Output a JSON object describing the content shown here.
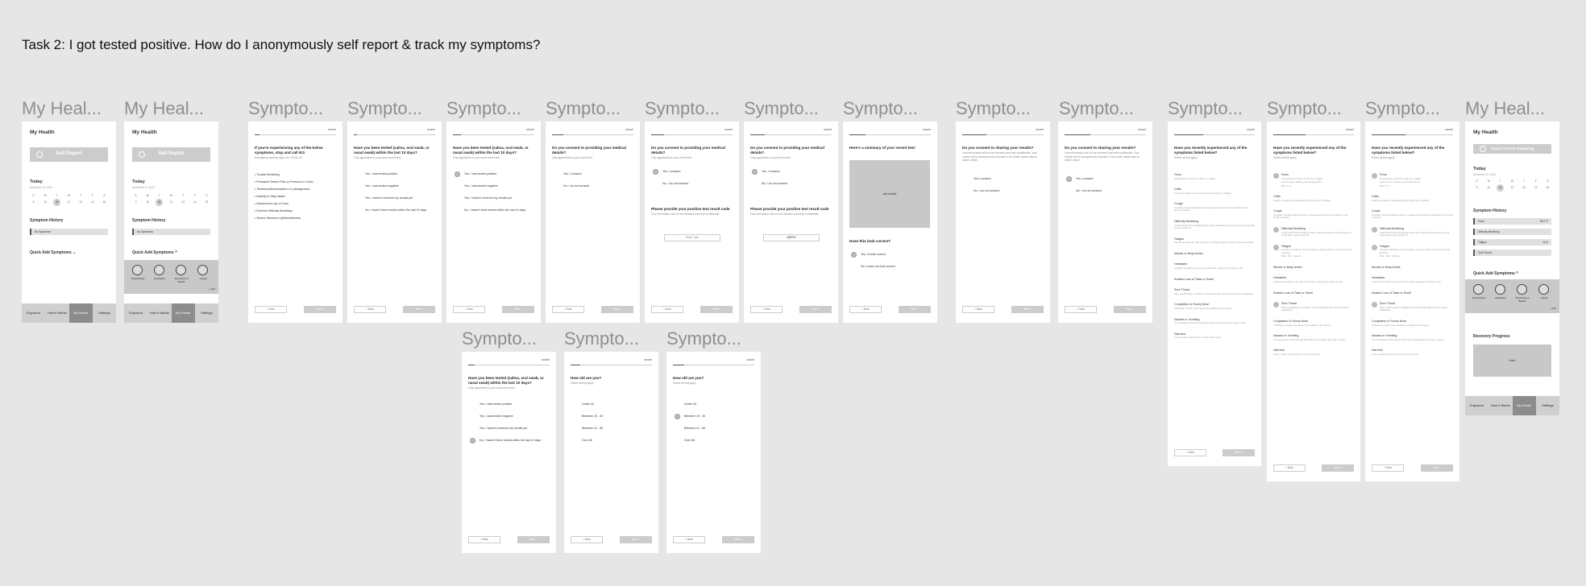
{
  "task": "Task 2: I got tested positive. How do I anonymously self report & track my symptoms?",
  "labels": {
    "my_health": "My Heal...",
    "symptoms": "Sympto..."
  },
  "nav": {
    "cancel": "cancel",
    "back": "< Back",
    "next": "Next >"
  },
  "my_health": {
    "title": "My Health",
    "self_report": "Self Report",
    "thank_you": "Thank You For Reporting",
    "today": "Today",
    "date": "November 11, 2020",
    "week_days": [
      "S",
      "M",
      "T",
      "W",
      "T",
      "F",
      "S"
    ],
    "week_nums": [
      "9",
      "10",
      "11",
      "12",
      "13",
      "14",
      "15"
    ],
    "history_title": "Symptom History",
    "no_symptoms": "No Symptoms",
    "quick_add": "Quick Add Symptoms",
    "chev_down": "⌄",
    "chev_up": "^",
    "quick_items": [
      "Temperature",
      "Headache",
      "Shortness of Breath",
      "Cough"
    ],
    "add_link": "+ Add",
    "history_items": [
      {
        "name": "Fever",
        "val": "99.5 °F"
      },
      {
        "name": "Difficulty Breathing",
        "val": ""
      },
      {
        "name": "Fatigue",
        "val": "4/10"
      },
      {
        "name": "Sore Throat",
        "val": ""
      }
    ],
    "recovery_title": "Recovery Progress",
    "chart": "chart",
    "tabs": [
      "Exposure",
      "How It Works",
      "My Health",
      "Settings"
    ]
  },
  "s1": {
    "q": "If you're experiencing any of the below symptoms, stop and call 911",
    "sub": "Emergency warning signs for COVID-19",
    "items": [
      "Trouble Breathing",
      "Persistent Severe Pain or Pressure in Chest",
      "Tiredness/Disorientation or Lethargicness",
      "Inability to Stay awake",
      "Discoloured Lips or Face",
      "Extreme Difficulty Breathing",
      "Severe Stomach Lightheadedness"
    ]
  },
  "tested": {
    "q": "Have you been tested (saliva, oral swab, or nasal swab) within the last 10 days?",
    "sub": "Only applicable to your most recent test",
    "opts": [
      "Yes, I was tested positive",
      "Yes, I was tested negative",
      "Yes, I haven't received my results yet",
      "No, I haven't been tested within the last 10 days"
    ]
  },
  "medical": {
    "q": "Do you consent to providing your medical details?",
    "sub": "Only applicable to your recent test",
    "opts": [
      "Yes, I consent",
      "No, I do not consent"
    ],
    "code_q": "Please provide your positive test result code",
    "code_sub": "Your information will not be released and kept confidential",
    "code_ph": "Enter Code",
    "code_val": "456FSH"
  },
  "summary": {
    "q": "Here's a summary of your recent test:",
    "img": "test details",
    "q2": "Does this look correct?",
    "opts": [
      "Yes, it looks correct",
      "No, it does not look correct"
    ]
  },
  "sharing": {
    "q": "Do you consent to sharing your results?",
    "sub": "Your information will not be released and kept confidential. Your results will be anonymously included in the public health data to inform others",
    "opts": [
      "Yes I consent",
      "No, I do not consent"
    ]
  },
  "age": {
    "q": "How old are you?",
    "sub": "Select all that apply",
    "opts": [
      "Under 18",
      "Between 19 - 40",
      "Between 41 - 65",
      "Over 65"
    ]
  },
  "symptoms": {
    "q": "Have you recently experienced any of the symptoms listed below?",
    "sub": "Select all that apply",
    "items": [
      {
        "name": "Fever",
        "desc": "Temperature of 100.4 °F (38 °C) or higher"
      },
      {
        "name": "Chills",
        "desc": "Feeling of coldness accompanied by shivering or shaking"
      },
      {
        "name": "Cough",
        "desc": "A sudden, forceful hacking sound to release air and clear an irritation in the throat or airway"
      },
      {
        "name": "Difficulty Breathing",
        "desc": "A discomfort when breathing that is often described as a feeling of not being able to get enough air"
      },
      {
        "name": "Fatigue",
        "desc": "Feeling of tiredness, lack of energy, or being unable to perform normal activities"
      },
      {
        "name": "Muscle or Body Aches",
        "desc": ""
      },
      {
        "name": "Headache",
        "desc": "A painful sensation in any part of the head, ranging from sharp to dull"
      },
      {
        "name": "Sudden Loss of Taste or Smell",
        "desc": ""
      },
      {
        "name": "Sore Throat",
        "desc": "Pain, scratchiness or irritation of the throat that often worsens when swallowing"
      },
      {
        "name": "Congestion or Runny Nose",
        "desc": "A blocked or stuffy nose caused by swelling of the tissues"
      },
      {
        "name": "Nausea or Vomiting",
        "desc": "An uneasiness of the stomach that often accompanies the urge to vomit"
      },
      {
        "name": "Diarrhea",
        "desc": "Loose, watery stools three or more times a day"
      }
    ],
    "temp_label": "Current temp. What's your temperature?",
    "temp_val": "99.5",
    "unit_f": "°F",
    "unit_c": "°C",
    "sev_low": "Mild",
    "sev_mid": "4/10",
    "sev_high": "Severe"
  }
}
